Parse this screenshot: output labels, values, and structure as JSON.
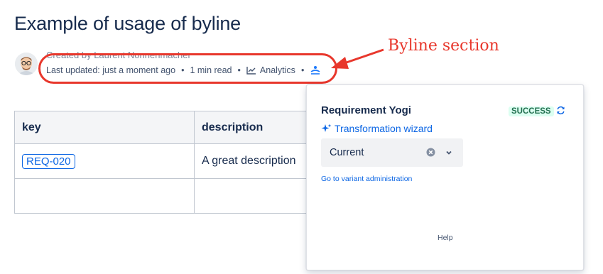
{
  "page": {
    "title": "Example of usage of byline"
  },
  "byline": {
    "created_by": "Created by Laurent Nonnenmacher",
    "last_updated": "Last updated: just a moment ago",
    "separator": "•",
    "read_time": "1 min read",
    "analytics_label": "Analytics",
    "yogi_icon": "requirement-yogi-icon"
  },
  "annotations": {
    "byline_label": "Byline section",
    "color": "#e8372c"
  },
  "table": {
    "headers": [
      "key",
      "description"
    ],
    "rows": [
      {
        "key": "REQ-020",
        "description": "A great description"
      },
      {
        "key": "",
        "description": ""
      }
    ]
  },
  "popup": {
    "title": "Requirement Yogi",
    "status": "SUCCESS",
    "wizard_link": "Transformation wizard",
    "variant_value": "Current",
    "variant_admin_link": "Go to variant administration",
    "help": "Help"
  },
  "colors": {
    "link": "#0c66e4",
    "success_bg": "#dcfff1",
    "success_text": "#216e4e",
    "heading": "#172b4d"
  }
}
